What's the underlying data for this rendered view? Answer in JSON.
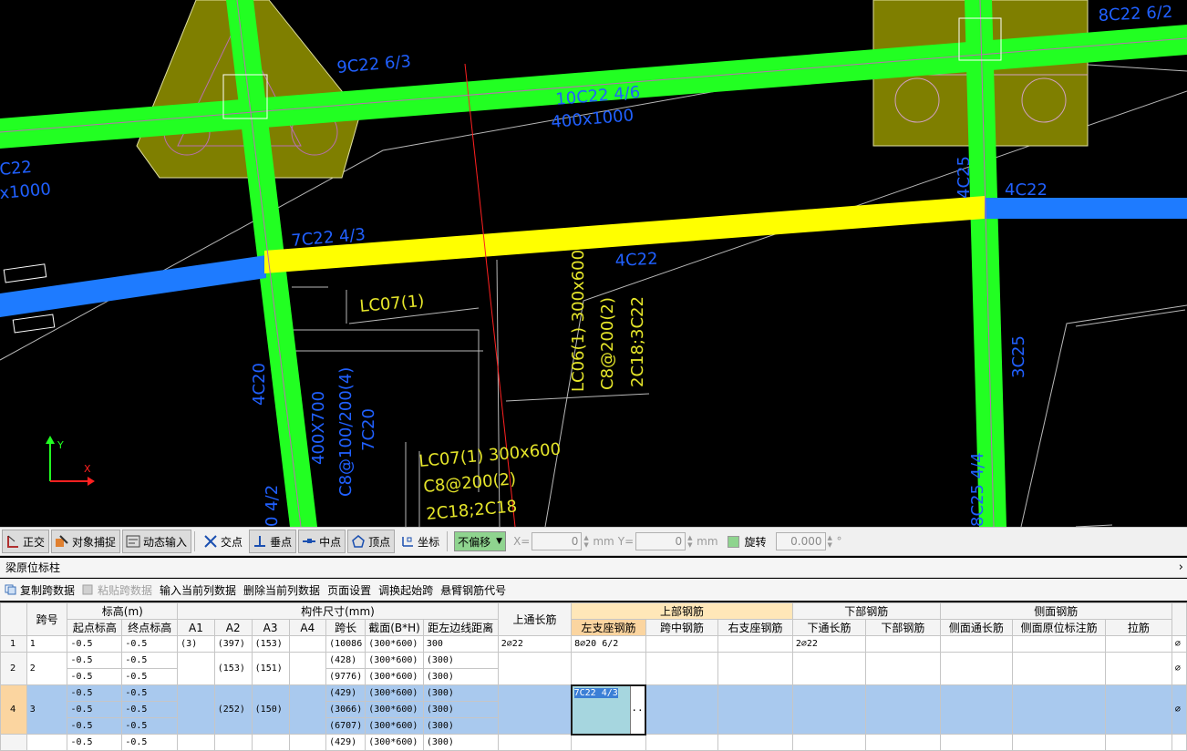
{
  "cad": {
    "labels": {
      "c1": "9C22 6/3",
      "c2": "10C22 4/6",
      "c3": "400x1000",
      "c4": "8C22 6/2",
      "c5": "C22",
      "c6": "x1000",
      "c7": "7C22 4/3",
      "c8": "4C22",
      "c9": "4C22",
      "c10": "4C25",
      "c11": "3C25",
      "c12": "4C20",
      "c13": "400X700",
      "c14": "C8@100/200(4)",
      "c15": "7C20",
      "c16": "0 4/2",
      "c17": "8C25 4/4",
      "y1": "LC07(1)",
      "y2": "LC06(1) 300x600",
      "y3": "C8@200(2)",
      "y4": "2C18;3C22",
      "y5": "LC07(1) 300x600",
      "y6": "C8@200(2)",
      "y7": "2C18;2C18"
    },
    "axis_y": "Y",
    "axis_x": "X"
  },
  "snapbar": {
    "ortho": "正交",
    "osnap": "对象捕捉",
    "dynamic": "动态输入",
    "intersection": "交点",
    "perpendicular": "垂点",
    "midpoint": "中点",
    "vertex": "顶点",
    "coordinate": "坐标",
    "offset_select": "不偏移",
    "x_label": "X=",
    "x_value": "0",
    "x_unit": "mm",
    "y_label": "Y=",
    "y_value": "0",
    "y_unit": "mm",
    "rotate_label": "旋转",
    "rotate_value": "0.000",
    "rotate_unit": "°"
  },
  "panel": {
    "title": "梁原位标柱",
    "collapse": "›"
  },
  "actions": {
    "copy_span": "复制跨数据",
    "paste_span": "粘贴跨数据",
    "input_col": "输入当前列数据",
    "delete_col": "删除当前列数据",
    "page_setup": "页面设置",
    "swap_start": "调换起始跨",
    "cantilever": "悬臂钢筋代号"
  },
  "grid": {
    "headers": {
      "span_no": "跨号",
      "elevation": "标高(m)",
      "start_elev": "起点标高",
      "end_elev": "终点标高",
      "size": "构件尺寸(mm)",
      "a1": "A1",
      "a2": "A2",
      "a3": "A3",
      "a4": "A4",
      "span_len": "跨长",
      "section": "截面(B*H)",
      "dist_left": "距左边线距离",
      "top_through": "上通长筋",
      "top_rebar": "上部钢筋",
      "left_support": "左支座钢筋",
      "mid_span": "跨中钢筋",
      "right_support": "右支座钢筋",
      "bottom_rebar": "下部钢筋",
      "bottom_through": "下通长筋",
      "bottom_bars": "下部钢筋",
      "side_rebar": "侧面钢筋",
      "side_through": "侧面通长筋",
      "side_inplace": "侧面原位标注筋",
      "tie": "拉筋"
    },
    "rows": [
      {
        "rn": "1",
        "span": "1",
        "start": "-0.5",
        "end": "-0.5",
        "a1": "(3)",
        "a2": "(397)",
        "a3": "(153)",
        "len": "(10086",
        "sec": "(300*600)",
        "dist": "300",
        "top": "2⌀22",
        "left": "8⌀20 6/2",
        "bottom": "2⌀22",
        "tail": "⌀"
      },
      {
        "rn": "2",
        "span": "2",
        "start": "-0.5",
        "end": "-0.5",
        "a2": "(153)",
        "a3": "(151)",
        "len": "(428)",
        "sec": "(300*600)",
        "dist": "(300)",
        "tail": "⌀"
      },
      {
        "start": "-0.5",
        "end": "-0.5",
        "len": "(9776)",
        "sec": "(300*600)",
        "dist": "(300)"
      },
      {
        "rn": "4",
        "span": "3",
        "start": "-0.5",
        "end": "-0.5",
        "a2": "(252)",
        "a3": "(150)",
        "len": "(429)",
        "sec": "(300*600)",
        "dist": "(300)",
        "left": "7C22 4/3",
        "tail": "⌀"
      },
      {
        "start": "-0.5",
        "end": "-0.5",
        "len": "(3066)",
        "sec": "(300*600)",
        "dist": "(300)"
      },
      {
        "start": "-0.5",
        "end": "-0.5",
        "len": "(6707)",
        "sec": "(300*600)",
        "dist": "(300)"
      },
      {
        "start": "-0.5",
        "end": "-0.5",
        "len": "(429)",
        "sec": "(300*600)",
        "dist": "(300)"
      }
    ],
    "edit_button": "..."
  },
  "colors": {
    "beam_green": "#22ff22",
    "beam_yellow": "#ffff00",
    "beam_blue": "#1e7bff",
    "column_olive": "#808000",
    "label_blue": "#2060ff",
    "label_yellow": "#e6e62a",
    "selected_row": "#a9c9ee",
    "header_highlight": "#fbd5a0"
  }
}
